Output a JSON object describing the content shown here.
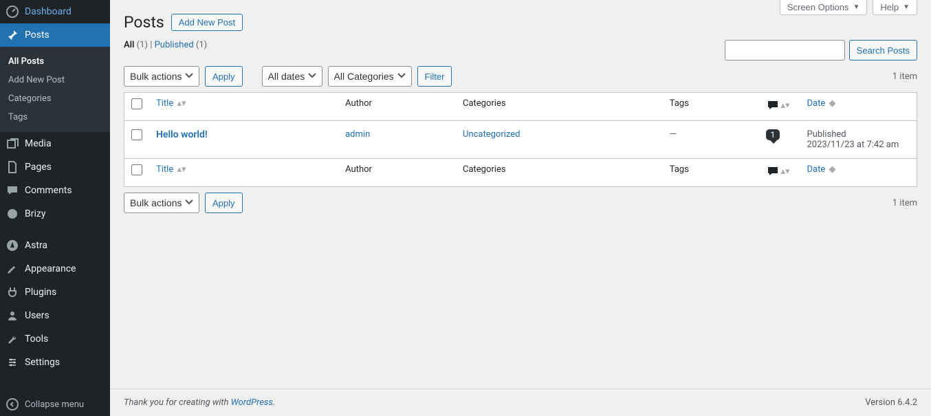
{
  "sidebar": {
    "items": [
      {
        "label": "Dashboard",
        "icon": "dashboard"
      },
      {
        "label": "Posts",
        "icon": "pin"
      },
      {
        "label": "Media",
        "icon": "media"
      },
      {
        "label": "Pages",
        "icon": "pages"
      },
      {
        "label": "Comments",
        "icon": "comment"
      },
      {
        "label": "Brizy",
        "icon": "brizy"
      },
      {
        "label": "Astra",
        "icon": "astra"
      },
      {
        "label": "Appearance",
        "icon": "brush"
      },
      {
        "label": "Plugins",
        "icon": "plug"
      },
      {
        "label": "Users",
        "icon": "user"
      },
      {
        "label": "Tools",
        "icon": "wrench"
      },
      {
        "label": "Settings",
        "icon": "settings"
      }
    ],
    "submenu": [
      "All Posts",
      "Add New Post",
      "Categories",
      "Tags"
    ],
    "collapse": "Collapse menu"
  },
  "top": {
    "screen_options": "Screen Options",
    "help": "Help"
  },
  "heading": {
    "title": "Posts",
    "add_new": "Add New Post"
  },
  "views": {
    "all_label": "All",
    "all_count": "(1)",
    "sep": " | ",
    "published_label": "Published",
    "published_count": "(1)"
  },
  "search": {
    "button": "Search Posts"
  },
  "nav": {
    "bulk": "Bulk actions",
    "apply": "Apply",
    "dates": "All dates",
    "cats": "All Categories",
    "filter": "Filter",
    "count": "1 item"
  },
  "cols": {
    "title": "Title",
    "author": "Author",
    "categories": "Categories",
    "tags": "Tags",
    "date": "Date"
  },
  "rows": [
    {
      "title": "Hello world!",
      "author": "admin",
      "categories": "Uncategorized",
      "tags": "—",
      "comments": "1",
      "status": "Published",
      "date": "2023/11/23 at 7:42 am"
    }
  ],
  "footer": {
    "thank": "Thank you for creating with ",
    "wp": "WordPress",
    "dot": ".",
    "version": "Version 6.4.2"
  }
}
